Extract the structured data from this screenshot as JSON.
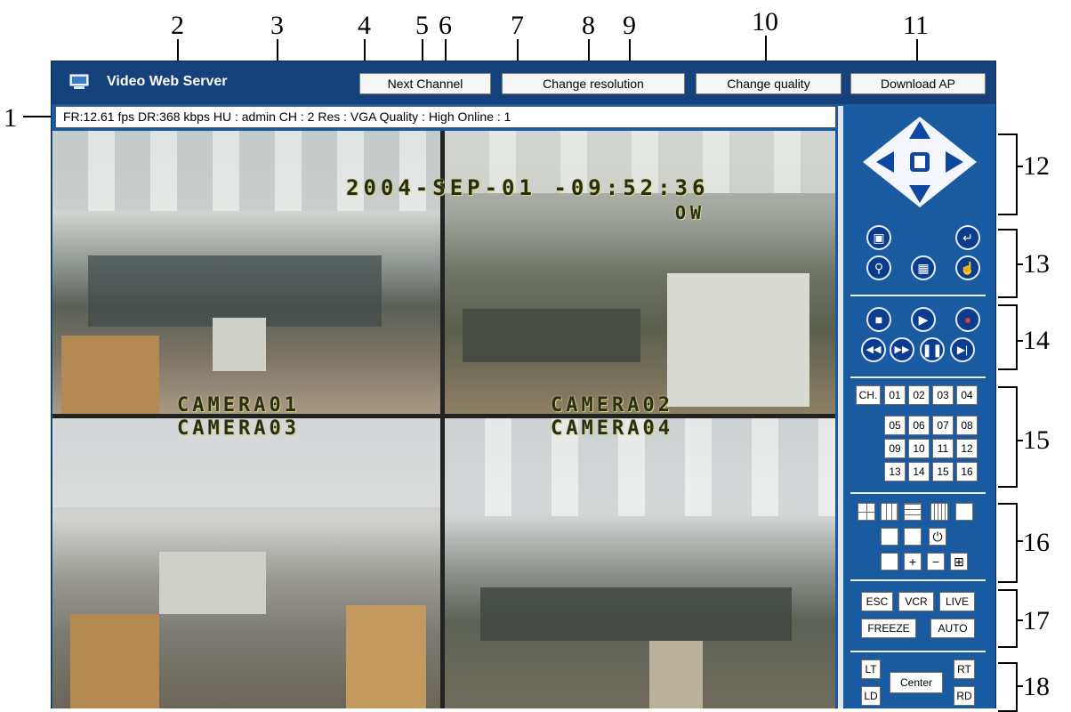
{
  "callouts": [
    "1",
    "2",
    "3",
    "4",
    "5",
    "6",
    "7",
    "8",
    "9",
    "10",
    "11",
    "12",
    "13",
    "14",
    "15",
    "16",
    "17",
    "18"
  ],
  "window": {
    "title": "Video Web Server"
  },
  "toolbar": {
    "next_channel": "Next Channel",
    "change_resolution": "Change resolution",
    "change_quality": "Change quality",
    "download_ap": "Download AP"
  },
  "status": {
    "text": "FR:12.61 fps  DR:368 kbps  HU : admin    CH : 2   Res : VGA   Quality : High    Online : 1"
  },
  "video": {
    "timestamp": "2004-SEP-01 -09:52:36",
    "osd_small": "OW",
    "cameras": [
      "CAMERA01",
      "CAMERA02",
      "CAMERA03",
      "CAMERA04"
    ]
  },
  "ptz": {
    "center_icon": "ptz-center-icon"
  },
  "channels": {
    "ch_label": "CH.",
    "numbers": [
      "01",
      "02",
      "03",
      "04",
      "05",
      "06",
      "07",
      "08",
      "09",
      "10",
      "11",
      "12",
      "13",
      "14",
      "15",
      "16"
    ]
  },
  "modes": {
    "esc": "ESC",
    "vcr": "VCR",
    "live": "LIVE",
    "freeze": "FREEZE",
    "auto": "AUTO"
  },
  "corners": {
    "lt": "LT",
    "ld": "LD",
    "center": "Center",
    "rt": "RT",
    "rd": "RD"
  },
  "colors": {
    "panel": "#1a5aa0",
    "titlebar": "#15427a",
    "callout": "#c00000"
  }
}
